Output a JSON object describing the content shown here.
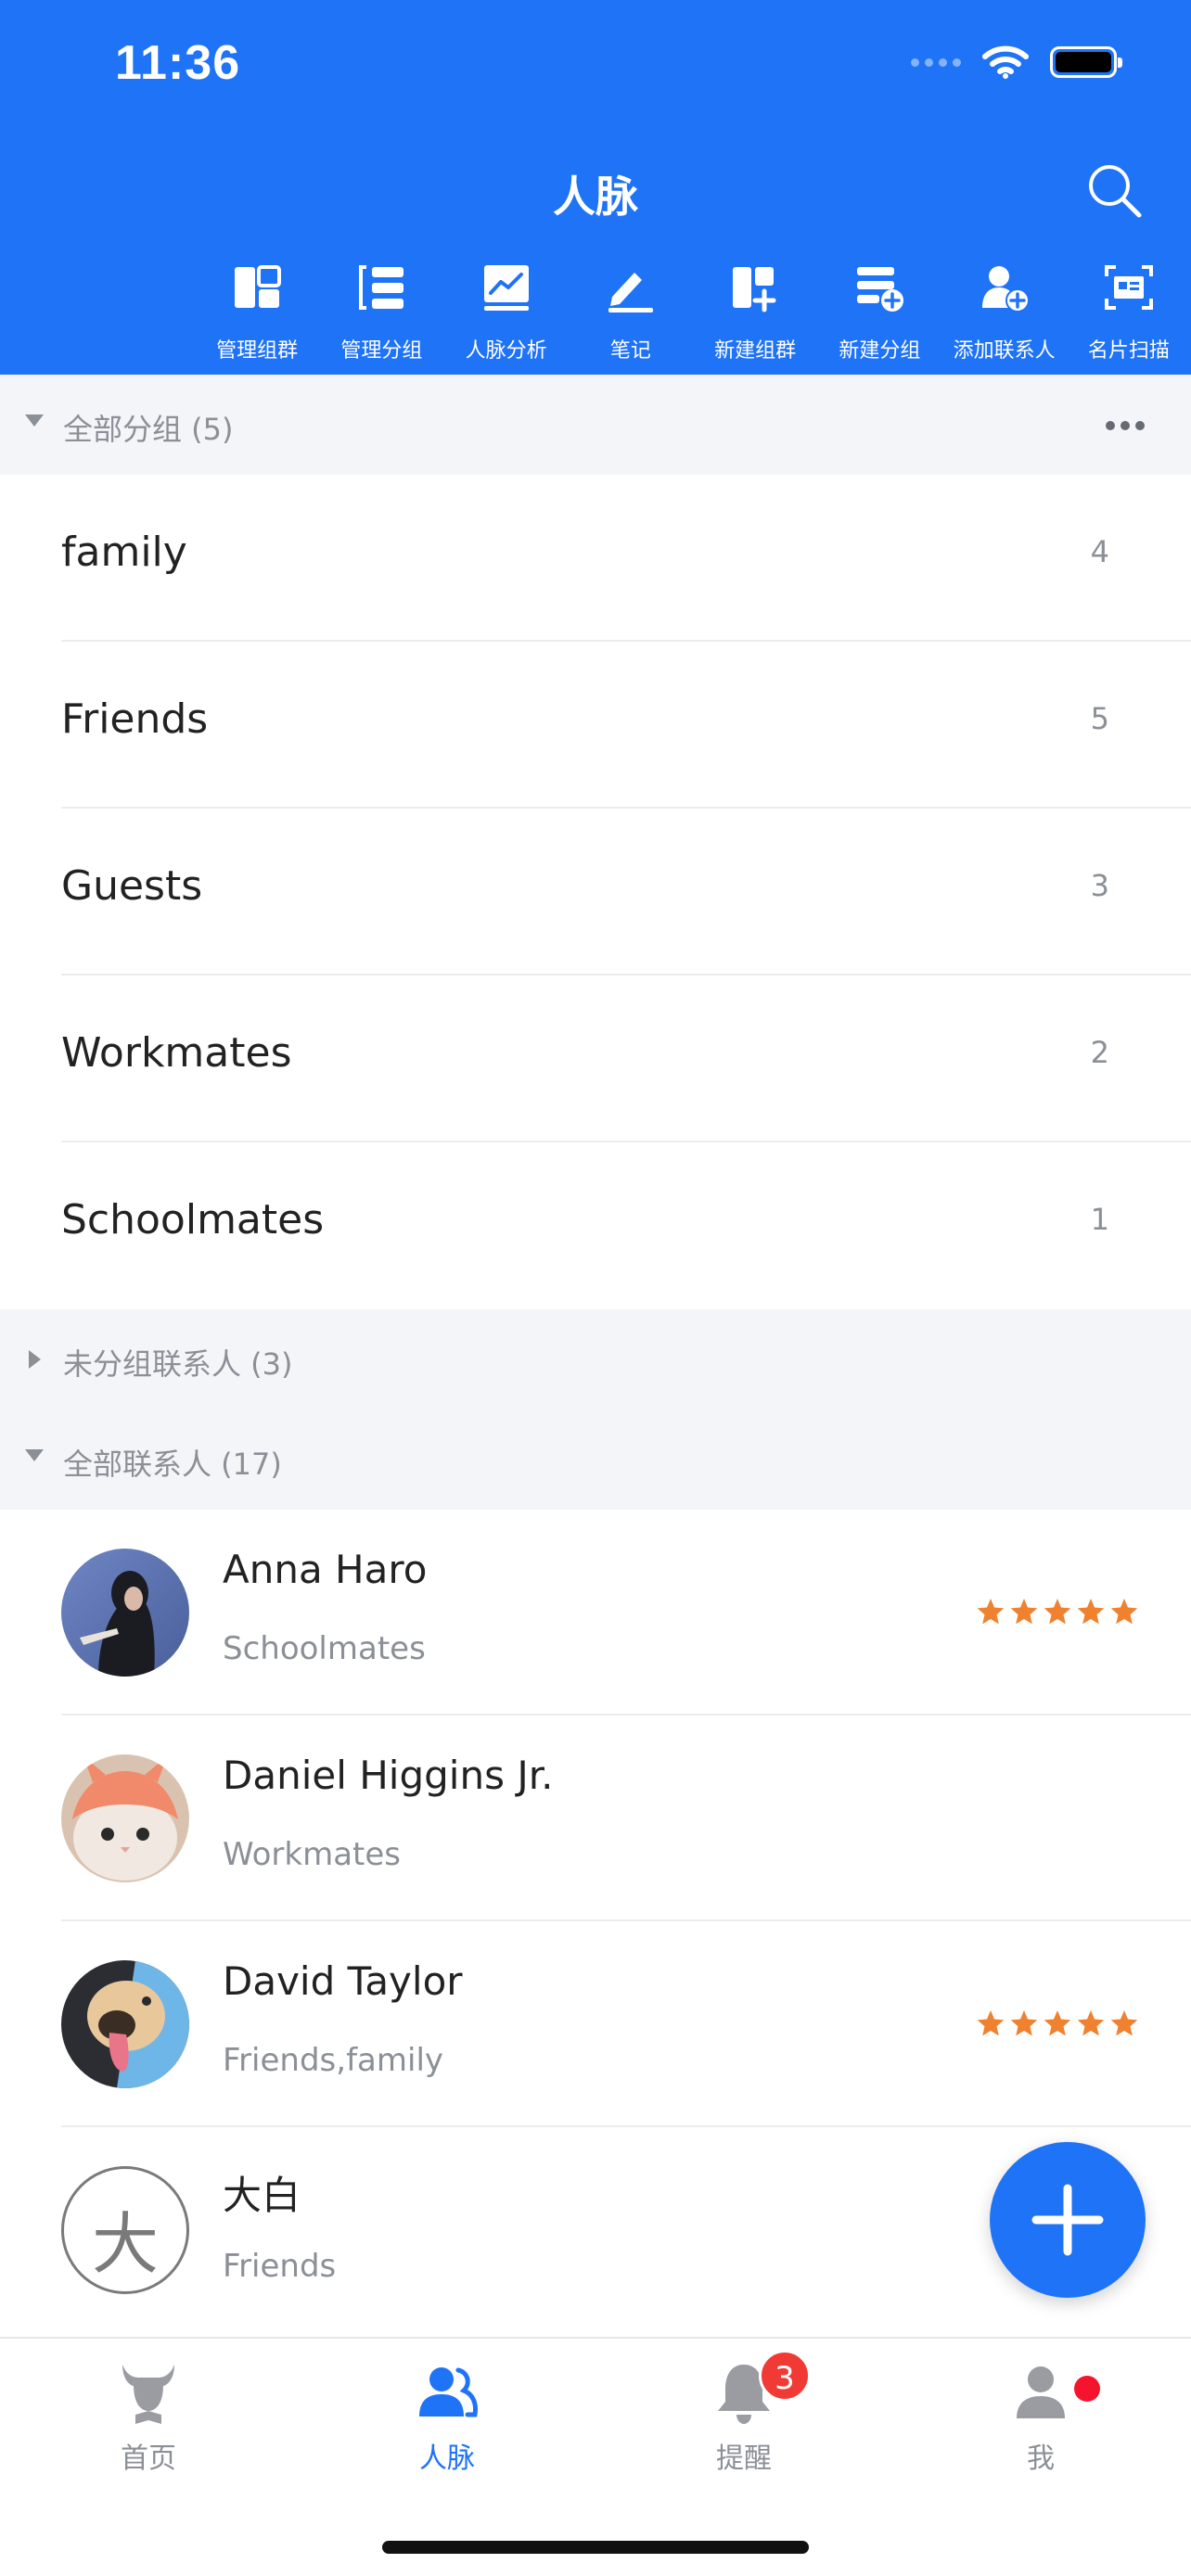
{
  "status_bar": {
    "time": "11:36"
  },
  "header": {
    "title": "人脉",
    "toolbar": [
      {
        "icon": "manage-groups-icon",
        "label": "管理组群"
      },
      {
        "icon": "manage-categories-icon",
        "label": "管理分组"
      },
      {
        "icon": "network-analysis-icon",
        "label": "人脉分析"
      },
      {
        "icon": "notes-icon",
        "label": "笔记"
      },
      {
        "icon": "new-group-icon",
        "label": "新建组群"
      },
      {
        "icon": "new-category-icon",
        "label": "新建分组"
      },
      {
        "icon": "add-contact-icon",
        "label": "添加联系人"
      },
      {
        "icon": "card-scan-icon",
        "label": "名片扫描"
      }
    ]
  },
  "all_groups": {
    "title": "全部分组 (5)",
    "items": [
      {
        "name": "family",
        "count": "4"
      },
      {
        "name": "Friends",
        "count": "5"
      },
      {
        "name": "Guests",
        "count": "3"
      },
      {
        "name": "Workmates",
        "count": "2"
      },
      {
        "name": "Schoolmates",
        "count": "1"
      }
    ]
  },
  "ungrouped": {
    "title": "未分组联系人 (3)"
  },
  "all_contacts": {
    "title": "全部联系人 (17)",
    "items": [
      {
        "name": "Anna Haro",
        "group": "Schoolmates",
        "stars": 5,
        "avatar": "photo"
      },
      {
        "name": "Daniel Higgins Jr.",
        "group": "Workmates",
        "stars": 0,
        "avatar": "photo"
      },
      {
        "name": "David Taylor",
        "group": "Friends,family",
        "stars": 5,
        "avatar": "photo"
      },
      {
        "name": "大白",
        "group": "Friends",
        "stars": 0,
        "avatar_letter": "大"
      }
    ]
  },
  "colors": {
    "primary": "#1f73f7",
    "star": "#f0812f",
    "badge": "#f23a35"
  },
  "tabbar": {
    "tabs": [
      {
        "label": "首页",
        "icon": "home-bull-icon"
      },
      {
        "label": "人脉",
        "icon": "contacts-icon",
        "active": true
      },
      {
        "label": "提醒",
        "icon": "bell-icon",
        "badge": "3"
      },
      {
        "label": "我",
        "icon": "profile-icon",
        "dot": true
      }
    ]
  }
}
